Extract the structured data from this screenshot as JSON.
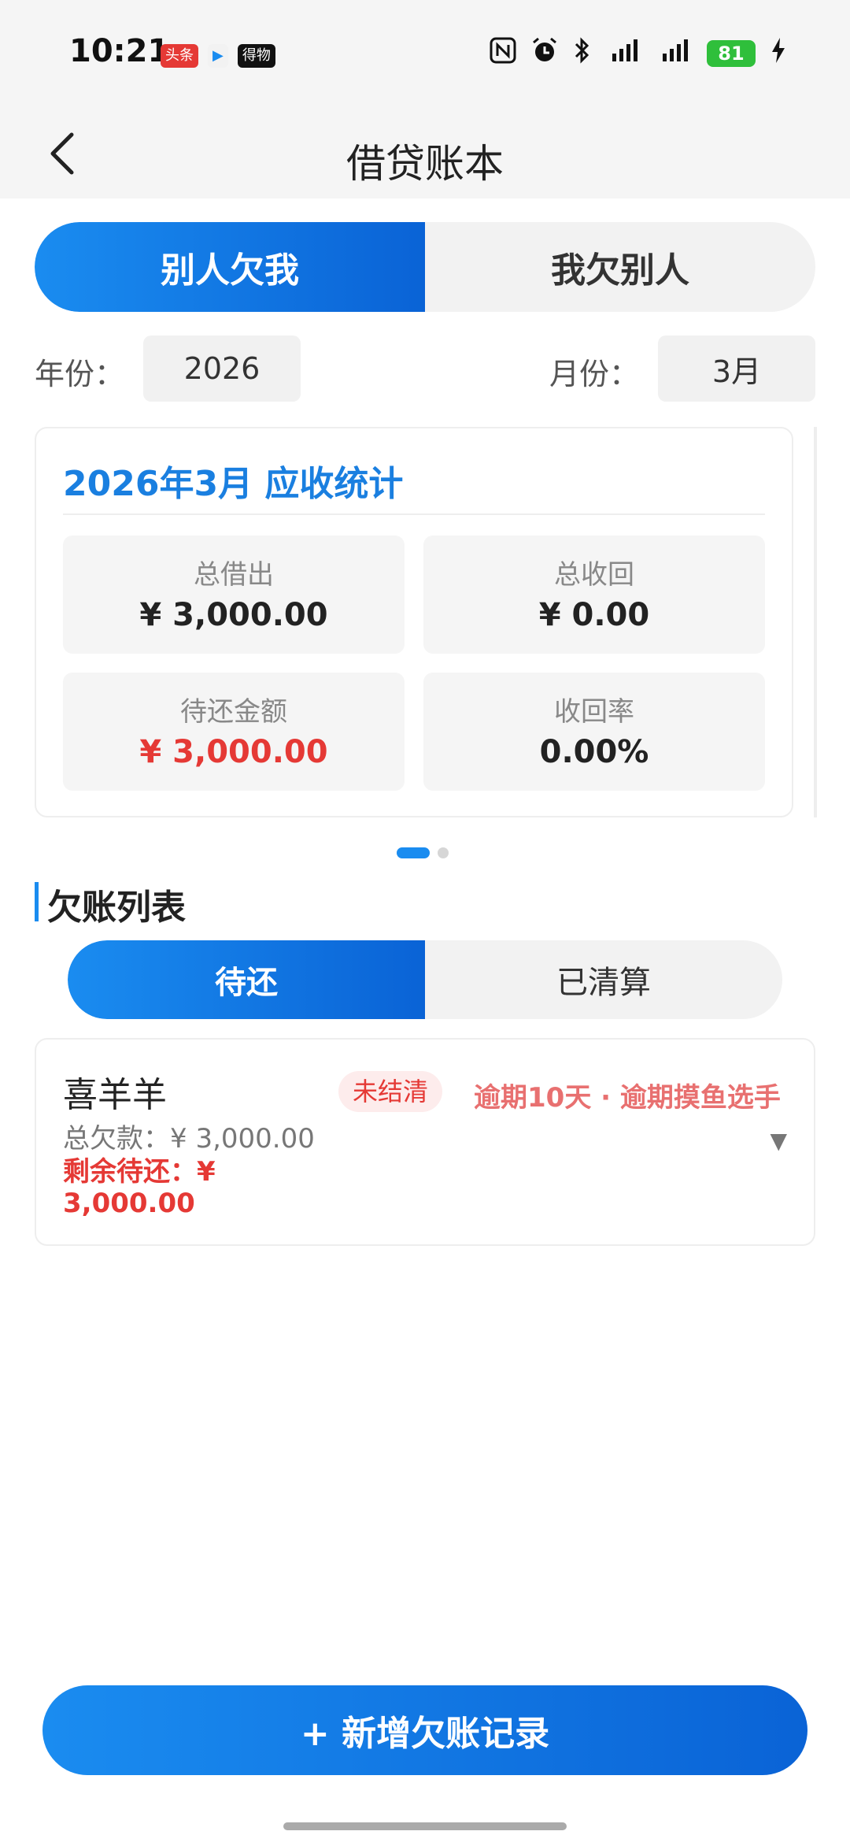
{
  "status": {
    "time": "10:21",
    "apps": [
      "头条",
      "▶",
      "得物"
    ],
    "battery": "81"
  },
  "nav": {
    "title": "借贷账本"
  },
  "mode_tabs": [
    {
      "label": "别人欠我",
      "active": true
    },
    {
      "label": "我欠别人",
      "active": false
    }
  ],
  "filters": {
    "year_label": "年份：",
    "year_value": "2026",
    "month_label": "月份：",
    "month_value": "3月"
  },
  "stats": {
    "title": "2026年3月 应收统计",
    "total_lent_label": "总借出",
    "total_lent_value": "¥ 3,000.00",
    "total_recovered_label": "总收回",
    "total_recovered_value": "¥ 0.00",
    "pending_label": "待还金额",
    "pending_value": "¥ 3,000.00",
    "rate_label": "收回率",
    "rate_value": "0.00%"
  },
  "list": {
    "title": "欠账列表",
    "tabs": [
      {
        "label": "待还",
        "active": true
      },
      {
        "label": "已清算",
        "active": false
      }
    ],
    "items": [
      {
        "name": "喜羊羊",
        "tag": "未结清",
        "overdue": "逾期10天 · 逾期摸鱼选手",
        "total": "总欠款：¥ 3,000.00",
        "remaining": "剩余待还：¥ 3,000.00"
      }
    ]
  },
  "add_button": {
    "label": "+ 新增欠账记录"
  },
  "colors": {
    "accent": "#1a8cf0",
    "danger": "#e53935"
  }
}
